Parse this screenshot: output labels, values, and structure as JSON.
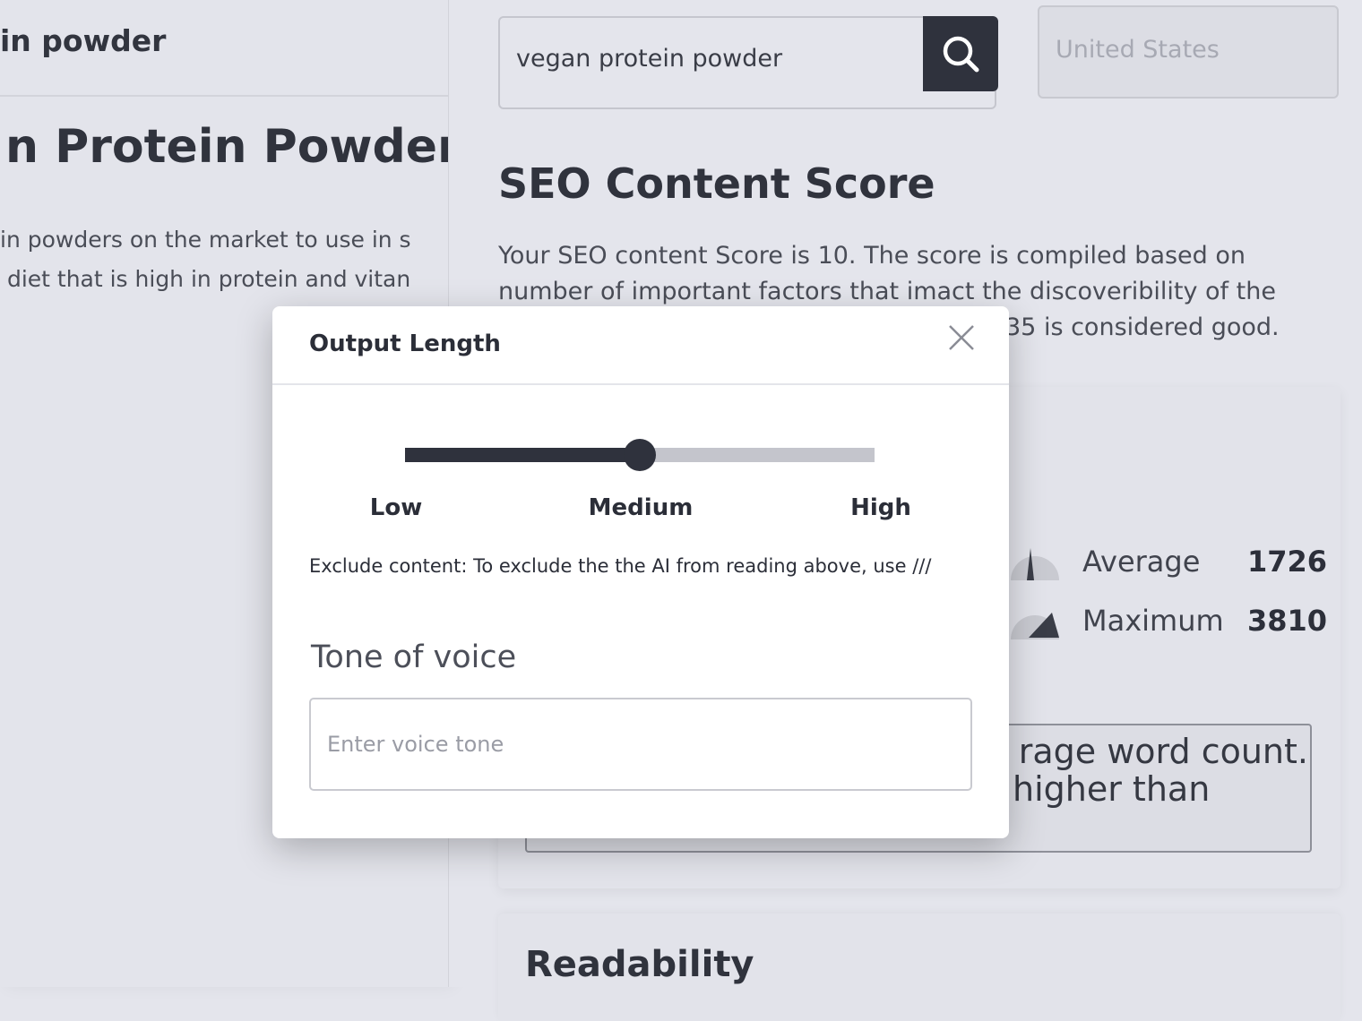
{
  "left_panel": {
    "keyword": "in powder",
    "title": "n Protein Powders",
    "desc_line1": "in powders on the market to use in s",
    "desc_line2": " diet that is high in protein and vitan"
  },
  "search": {
    "query": "vegan protein powder",
    "icon": "search-icon",
    "country_placeholder": "United States"
  },
  "seo": {
    "title": "SEO Content Score",
    "description": "Your SEO content Score is 10. The score is compiled based on number of important factors that imact the discoveribility of the",
    "description_tail": "35 is considered good."
  },
  "word_count": {
    "average_label": "Average",
    "average_value": "1726",
    "maximum_label": "Maximum",
    "maximum_value": "3810",
    "note_line1": "rage word count.",
    "note_line2": "higher than"
  },
  "readability": {
    "title": "Readability"
  },
  "modal": {
    "title": "Output Length",
    "close_icon": "close-icon",
    "slider": {
      "labels": [
        "Low",
        "Medium",
        "High"
      ],
      "value_fraction": 0.5,
      "selected": "Medium"
    },
    "exclude_text": "Exclude content: To exclude the the AI from reading above, use ///",
    "tone_title": "Tone of voice",
    "tone_placeholder": "Enter voice tone",
    "tone_value": ""
  },
  "colors": {
    "accent_dark": "#2f323d",
    "overlay_bg": "#e4e5ec",
    "modal_bg": "#ffffff"
  }
}
